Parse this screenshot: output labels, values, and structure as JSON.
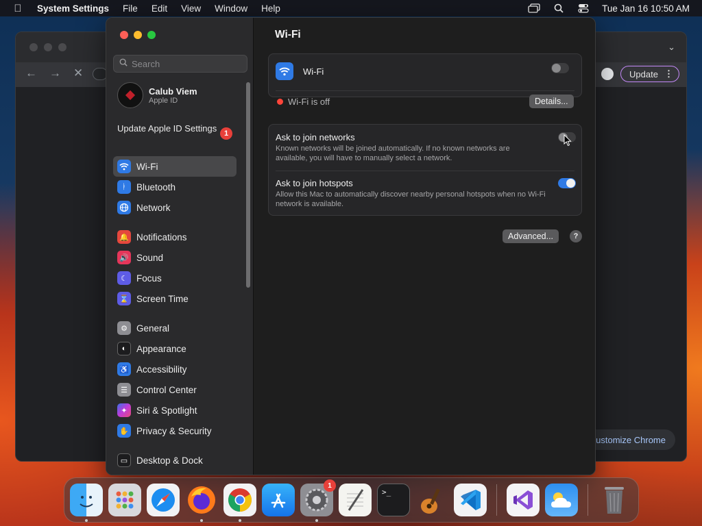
{
  "menubar": {
    "app_name": "System Settings",
    "items": [
      "File",
      "Edit",
      "View",
      "Window",
      "Help"
    ],
    "clock": "Tue Jan 16  10:50 AM"
  },
  "chrome": {
    "update_label": "Update",
    "customize_label": "ustomize Chrome"
  },
  "sidebar": {
    "search_placeholder": "Search",
    "account_name": "Calub Viem",
    "account_sub": "Apple ID",
    "update_apple_id": "Update Apple ID Settings",
    "update_badge": "1",
    "items": [
      {
        "label": "Wi-Fi",
        "icon": "wifi-icon",
        "color": "#2f7ae5"
      },
      {
        "label": "Bluetooth",
        "icon": "bluetooth-icon",
        "color": "#2f7ae5"
      },
      {
        "label": "Network",
        "icon": "globe-icon",
        "color": "#2f7ae5"
      },
      {
        "label": "Notifications",
        "icon": "bell-icon",
        "color": "#e5473d"
      },
      {
        "label": "Sound",
        "icon": "speaker-icon",
        "color": "#e5365a"
      },
      {
        "label": "Focus",
        "icon": "moon-icon",
        "color": "#5e5ce6"
      },
      {
        "label": "Screen Time",
        "icon": "hourglass-icon",
        "color": "#5e5ce6"
      },
      {
        "label": "General",
        "icon": "gear-icon",
        "color": "#8e8e93"
      },
      {
        "label": "Appearance",
        "icon": "appearance-icon",
        "color": "#1c1c1e"
      },
      {
        "label": "Accessibility",
        "icon": "accessibility-icon",
        "color": "#2f7ae5"
      },
      {
        "label": "Control Center",
        "icon": "control-center-icon",
        "color": "#8e8e93"
      },
      {
        "label": "Siri & Spotlight",
        "icon": "siri-icon",
        "color": "#a03bd8"
      },
      {
        "label": "Privacy & Security",
        "icon": "hand-icon",
        "color": "#2f7ae5"
      },
      {
        "label": "Desktop & Dock",
        "icon": "dock-icon",
        "color": "#1c1c1e"
      }
    ]
  },
  "content": {
    "title": "Wi-Fi",
    "wifi_label": "Wi-Fi",
    "wifi_status": "Wi-Fi is off",
    "details_button": "Details...",
    "ask_networks_title": "Ask to join networks",
    "ask_networks_desc": "Known networks will be joined automatically. If no known networks are available, you will have to manually select a network.",
    "ask_hotspots_title": "Ask to join hotspots",
    "ask_hotspots_desc": "Allow this Mac to automatically discover nearby personal hotspots when no Wi-Fi network is available.",
    "advanced_button": "Advanced...",
    "help_label": "?"
  },
  "dock": {
    "settings_badge": "1",
    "apps": [
      "Finder",
      "Launchpad",
      "Safari",
      "Firefox",
      "Chrome",
      "App Store",
      "System Settings",
      "TextEdit",
      "Terminal",
      "GarageBand",
      "VS Code",
      "Visual Studio",
      "Weather",
      "Trash"
    ]
  }
}
